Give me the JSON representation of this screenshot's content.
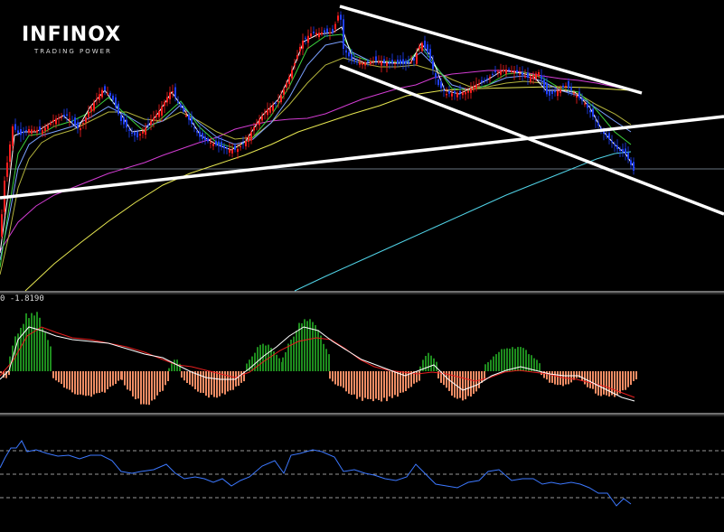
{
  "brand": {
    "name": "INFINOX",
    "tagline": "TRADING POWER"
  },
  "header_label": "",
  "macd_label": "0 -1.8190",
  "colors": {
    "background": "#000000",
    "bull_candle": "#ff1e1e",
    "bear_candle": "#2040ff",
    "ma_fast": "#ffffff",
    "ma_green": "#3cd23c",
    "ma_mid": "#7aa0ff",
    "ma_olive": "#b4b43c",
    "ma_magenta": "#d23cd2",
    "ma_yellow": "#e6e650",
    "ma_cyan": "#50d2e6",
    "trendline": "#ffffff",
    "macd_pos": "#1e8c1e",
    "macd_neg": "#f08c64",
    "macd_line": "#ffffff",
    "signal_line": "#e61e1e",
    "osc_line": "#3c78ff",
    "grid_dash": "#cccccc"
  },
  "chart_data": [
    {
      "type": "candlestick",
      "panel": "price",
      "key_points": [
        [
          0,
          262
        ],
        [
          5,
          200
        ],
        [
          14,
          140
        ],
        [
          22,
          150
        ],
        [
          32,
          143
        ],
        [
          46,
          145
        ],
        [
          60,
          132
        ],
        [
          74,
          128
        ],
        [
          88,
          144
        ],
        [
          100,
          120
        ],
        [
          114,
          98
        ],
        [
          124,
          108
        ],
        [
          134,
          134
        ],
        [
          144,
          146
        ],
        [
          152,
          152
        ],
        [
          164,
          138
        ],
        [
          176,
          123
        ],
        [
          190,
          99
        ],
        [
          198,
          116
        ],
        [
          210,
          134
        ],
        [
          222,
          153
        ],
        [
          236,
          159
        ],
        [
          250,
          165
        ],
        [
          262,
          166
        ],
        [
          272,
          156
        ],
        [
          284,
          136
        ],
        [
          296,
          121
        ],
        [
          308,
          112
        ],
        [
          318,
          90
        ],
        [
          326,
          70
        ],
        [
          334,
          46
        ],
        [
          344,
          37
        ],
        [
          356,
          36
        ],
        [
          368,
          36
        ],
        [
          376,
          11
        ],
        [
          380,
          54
        ],
        [
          390,
          68
        ],
        [
          402,
          70
        ],
        [
          414,
          67
        ],
        [
          426,
          69
        ],
        [
          436,
          70
        ],
        [
          448,
          71
        ],
        [
          458,
          67
        ],
        [
          466,
          46
        ],
        [
          474,
          60
        ],
        [
          484,
          93
        ],
        [
          494,
          104
        ],
        [
          504,
          103
        ],
        [
          516,
          102
        ],
        [
          526,
          94
        ],
        [
          536,
          90
        ],
        [
          548,
          80
        ],
        [
          560,
          77
        ],
        [
          572,
          80
        ],
        [
          584,
          86
        ],
        [
          596,
          80
        ],
        [
          606,
          107
        ],
        [
          616,
          101
        ],
        [
          626,
          95
        ],
        [
          636,
          104
        ],
        [
          646,
          113
        ],
        [
          656,
          129
        ],
        [
          666,
          146
        ],
        [
          676,
          156
        ],
        [
          684,
          166
        ],
        [
          692,
          170
        ],
        [
          702,
          191
        ]
      ]
    },
    {
      "type": "histogram",
      "panel": "macd",
      "segments": [
        [
          0,
          10,
          -0.15
        ],
        [
          10,
          58,
          1.0
        ],
        [
          58,
          134,
          -0.55
        ],
        [
          134,
          186,
          -0.7
        ],
        [
          186,
          200,
          0.2
        ],
        [
          200,
          272,
          -0.55
        ],
        [
          272,
          312,
          0.45
        ],
        [
          312,
          364,
          0.85
        ],
        [
          364,
          464,
          -0.65
        ],
        [
          464,
          484,
          0.3
        ],
        [
          484,
          536,
          -0.6
        ],
        [
          536,
          598,
          0.42
        ],
        [
          598,
          640,
          -0.32
        ],
        [
          640,
          704,
          -0.55
        ]
      ]
    },
    {
      "type": "line",
      "panel": "oscillator",
      "series": [
        {
          "name": "",
          "key_points": [
            [
              0,
              518
            ],
            [
              6,
              506
            ],
            [
              12,
              496
            ],
            [
              18,
              496
            ],
            [
              24,
              488
            ],
            [
              30,
              500
            ],
            [
              40,
              498
            ],
            [
              52,
              502
            ],
            [
              64,
              505
            ],
            [
              76,
              504
            ],
            [
              88,
              508
            ],
            [
              100,
              504
            ],
            [
              112,
              504
            ],
            [
              124,
              510
            ],
            [
              134,
              522
            ],
            [
              146,
              524
            ],
            [
              156,
              522
            ],
            [
              170,
              520
            ],
            [
              184,
              514
            ],
            [
              194,
              524
            ],
            [
              204,
              530
            ],
            [
              216,
              528
            ],
            [
              226,
              530
            ],
            [
              236,
              534
            ],
            [
              246,
              530
            ],
            [
              256,
              538
            ],
            [
              266,
              532
            ],
            [
              276,
              528
            ],
            [
              290,
              516
            ],
            [
              304,
              510
            ],
            [
              314,
              524
            ],
            [
              322,
              504
            ],
            [
              332,
              502
            ],
            [
              346,
              498
            ],
            [
              356,
              500
            ],
            [
              370,
              506
            ],
            [
              380,
              522
            ],
            [
              392,
              520
            ],
            [
              404,
              524
            ],
            [
              414,
              526
            ],
            [
              426,
              530
            ],
            [
              438,
              532
            ],
            [
              450,
              528
            ],
            [
              460,
              514
            ],
            [
              470,
              524
            ],
            [
              482,
              536
            ],
            [
              494,
              538
            ],
            [
              506,
              540
            ],
            [
              518,
              534
            ],
            [
              530,
              532
            ],
            [
              540,
              522
            ],
            [
              552,
              520
            ],
            [
              566,
              532
            ],
            [
              578,
              530
            ],
            [
              590,
              530
            ],
            [
              600,
              536
            ],
            [
              610,
              534
            ],
            [
              620,
              536
            ],
            [
              632,
              534
            ],
            [
              642,
              536
            ],
            [
              652,
              540
            ],
            [
              662,
              546
            ],
            [
              672,
              546
            ],
            [
              682,
              560
            ],
            [
              690,
              552
            ],
            [
              698,
              558
            ]
          ]
        }
      ]
    }
  ]
}
